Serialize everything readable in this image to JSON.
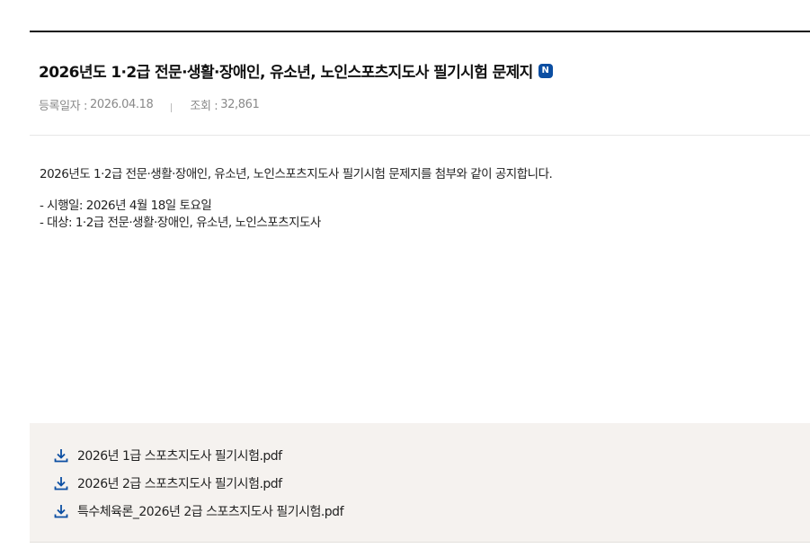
{
  "post": {
    "title": "2026년도 1·2급 전문·생활·장애인, 유소년, 노인스포츠지도사 필기시험 문제지",
    "new_badge": "N",
    "meta": {
      "date_label": "등록일자 :",
      "date_value": "2026.04.18",
      "views_label": "조회 :",
      "views_value": "32,861"
    },
    "body": {
      "intro": "2026년도 1·2급 전문·생활·장애인, 유소년, 노인스포츠지도사 필기시험 문제지를 첨부와 같이 공지합니다.",
      "line_date": "- 시행일: 2026년 4월 18일 토요일",
      "line_target": "- 대상: 1·2급 전문·생활·장애인, 유소년, 노인스포츠지도사"
    }
  },
  "attachments": [
    {
      "name": "2026년 1급 스포츠지도사 필기시험.pdf",
      "icon": "download-icon"
    },
    {
      "name": "2026년 2급 스포츠지도사 필기시험.pdf",
      "icon": "download-icon"
    },
    {
      "name": "특수체육론_2026년 2급 스포츠지도사 필기시험.pdf",
      "icon": "download-icon"
    }
  ],
  "colors": {
    "accent": "#0b4ea2",
    "attach_bg": "#f5f2ef",
    "meta_text": "#8a8a8a"
  }
}
